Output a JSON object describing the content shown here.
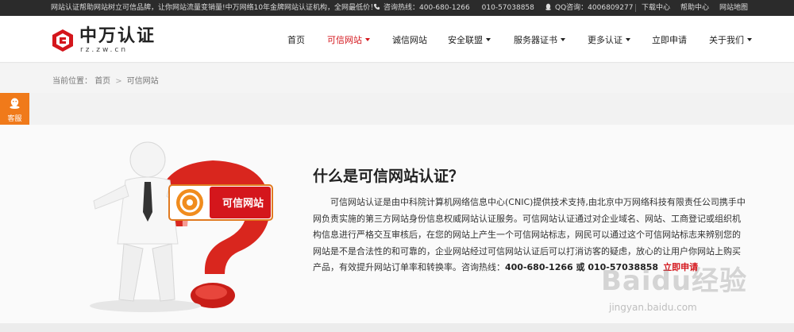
{
  "topbar": {
    "promo": "网站认证帮助网站树立可信品牌，让你网站流量变销量!中万网络10年金牌网站认证机构，全网最低价！",
    "hotline_label": "咨询热线：400-680-1266",
    "hotline_alt": "010-57038858",
    "qq": "QQ咨询：4006809277",
    "links": [
      "下载中心",
      "帮助中心",
      "网站地图"
    ]
  },
  "logo": {
    "brand": "中万认证",
    "domain": "rz.zw.cn"
  },
  "nav": {
    "items": [
      {
        "label": "首页",
        "dropdown": false
      },
      {
        "label": "可信网站",
        "dropdown": true
      },
      {
        "label": "诚信网站",
        "dropdown": false
      },
      {
        "label": "安全联盟",
        "dropdown": true
      },
      {
        "label": "服务器证书",
        "dropdown": true
      },
      {
        "label": "更多认证",
        "dropdown": true
      },
      {
        "label": "立即申请",
        "dropdown": false
      },
      {
        "label": "关于我们",
        "dropdown": true
      }
    ],
    "active_index": 1
  },
  "breadcrumb": {
    "prefix": "当前位置：",
    "home": "首页",
    "sep": ">",
    "current": "可信网站"
  },
  "kefu": {
    "label": "客服",
    "icon": "chat-bubble-icon"
  },
  "main": {
    "badge": "可信网站",
    "heading": "什么是可信网站认证？",
    "desc": "可信网站认证是由中科院计算机网络信息中心(CNIC)提供技术支持,由北京中万网络科技有限责任公司携手中网负责实施的第三方网站身份信息权威网站认证服务。可信网站认证通过对企业域名、网站、工商登记或组织机构信息进行严格交互审核后，在您的网站上产生一个可信网站标志，网民可以通过这个可信网站标志来辨别您的网站是不是合法性的和可靠的，企业网站经过可信网站认证后可以打消访客的疑虑，放心的让用户你网站上购买产品，有效提升网站订单率和转换率。咨询热线：",
    "phone": "400-680-1266 或 010-57038858",
    "apply": "立即申请"
  },
  "watermark": {
    "big": "Baidu经验",
    "small": "jingyan.baidu.com"
  },
  "colors": {
    "accent": "#d4161c",
    "topbar_bg": "#2b2b2b",
    "kefu_bg": "#f07a1a"
  }
}
